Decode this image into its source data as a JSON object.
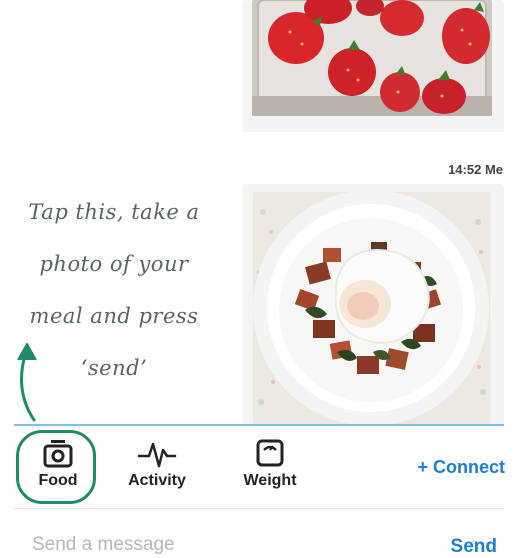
{
  "messages": [
    {
      "type": "photo",
      "subject": "strawberries"
    },
    {
      "type": "photo",
      "subject": "meal",
      "time": "14:52",
      "sender": "Me"
    }
  ],
  "annotation": {
    "lines": [
      "Tap this, take a",
      "photo of your",
      "meal and press",
      "‘send’"
    ],
    "color": "#1f8a6d"
  },
  "toolbar": {
    "food": {
      "label": "Food",
      "icon": "camera-icon"
    },
    "activity": {
      "label": "Activity",
      "icon": "pulse-icon"
    },
    "weight": {
      "label": "Weight",
      "icon": "scale-icon"
    },
    "connect_label": "+ Connect"
  },
  "composer": {
    "placeholder": "Send a message",
    "send_label": "Send"
  },
  "colors": {
    "accent_blue": "#1d7fd0",
    "highlight_green": "#1f8a6d",
    "toolbar_line": "#7fbfe6"
  }
}
